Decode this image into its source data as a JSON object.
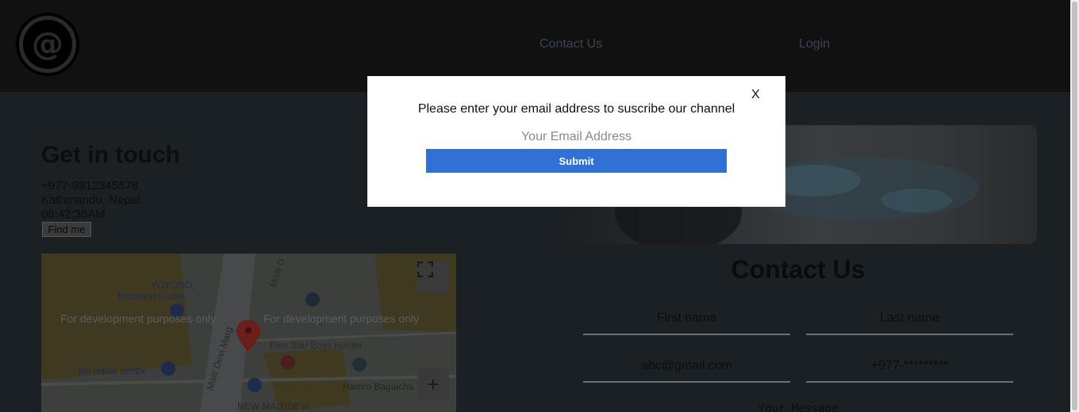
{
  "header": {
    "logo_icon": "at-sign-logo",
    "logo_glyph": "@",
    "nav": {
      "contact_label": "Contact Us",
      "login_label": "Login"
    }
  },
  "left": {
    "heading": "Get in touch",
    "phone": "+977-9812345678",
    "city": "Kathmandu, Nepal",
    "time": "08:42:38AM",
    "find_button": "Find me"
  },
  "map": {
    "labels": [
      "YOYOSO,",
      "Maitidevi Outlet",
      "jitu repair centre",
      "Five Star Boys Hostel",
      "Hamro Bagaicha",
      "NEW MAITIDEVI",
      "Maiti Devi Marg",
      "Maiti D"
    ],
    "dev_watermark": "For development purposes only",
    "fullscreen_icon": "fullscreen-icon",
    "zoom_in_icon": "plus-icon",
    "zoom_in_glyph": "+",
    "marker_icon": "map-pin-icon"
  },
  "right": {
    "contact_title": "Contact Us",
    "fields": {
      "first_name": "First name",
      "last_name": "Last name",
      "email": "abc@gmail.com",
      "phone": "+977-*********",
      "message": "Your Message"
    }
  },
  "modal": {
    "close_label": "X",
    "prompt": "Please enter your email address to suscribe our channel",
    "email_placeholder": "Your Email Address",
    "submit_label": "Submit"
  },
  "colors": {
    "accent": "#3071d6",
    "header_bg": "#111111",
    "overlay_bg": "#1a2024"
  }
}
